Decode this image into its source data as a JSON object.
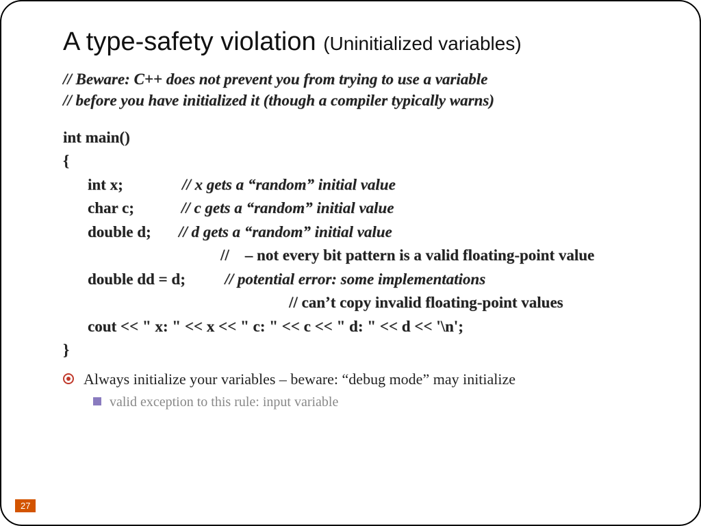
{
  "title": {
    "main": "A type-safety violation ",
    "sub": "(Uninitialized variables)"
  },
  "topComments": [
    "// Beware: C++ does not prevent you from trying to use a variable",
    "// before you have initialized it  (though a compiler typically warns)"
  ],
  "code": {
    "l1": "int main()",
    "l2": "{",
    "l3": {
      "c": "int x;",
      "cm": "// x gets a “random” initial value"
    },
    "l4": {
      "c": "char c;",
      "cm": "// c gets a “random” initial value"
    },
    "l5": {
      "c": "double d;",
      "cm": "// d gets a “random” initial value"
    },
    "l6": "//    – not every bit pattern is a valid floating-point value",
    "l7": {
      "c": "double dd = d;",
      "cm": "// potential error: some implementations"
    },
    "l8": "// can’t copy invalid floating-point values",
    "l9": "cout << \" x: \" << x << \" c: \" << c << \" d: \" << d << '\\n';",
    "l10": "}"
  },
  "bullets": {
    "b1": "Always initialize your variables – beware: “debug mode” may initialize",
    "b2": "valid exception to this rule: input variable"
  },
  "pageNumber": "27"
}
